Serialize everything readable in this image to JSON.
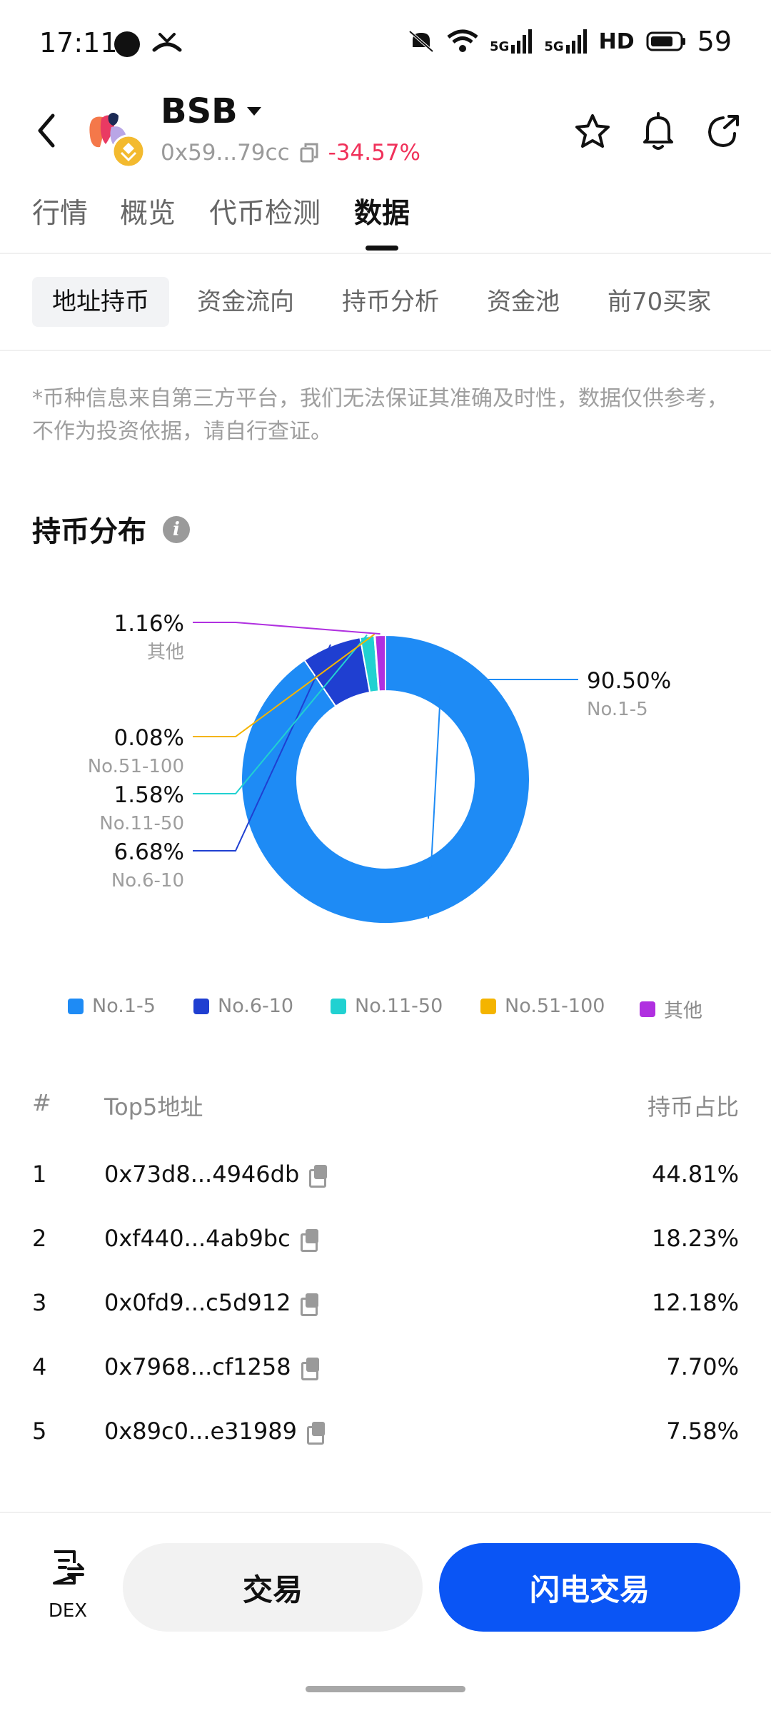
{
  "status_bar": {
    "time": "17:11",
    "battery": "59",
    "net1": "5G",
    "net2": "5G",
    "hd": "HD"
  },
  "header": {
    "token_name": "BSB",
    "address": "0x59...79cc",
    "change": "-34.57%"
  },
  "main_tabs": [
    {
      "label": "行情"
    },
    {
      "label": "概览"
    },
    {
      "label": "代币检测"
    },
    {
      "label": "数据",
      "active": true
    }
  ],
  "sub_tabs": [
    {
      "label": "地址持币",
      "active": true
    },
    {
      "label": "资金流向"
    },
    {
      "label": "持币分析"
    },
    {
      "label": "资金池"
    },
    {
      "label": "前70买家"
    }
  ],
  "disclaimer": "*币种信息来自第三方平台，我们无法保证其准确及时性，数据仅供参考，不作为投资依据，请自行查证。",
  "section_title": "持币分布",
  "chart_data": {
    "type": "pie",
    "donut": true,
    "categories": [
      "No.1-5",
      "No.6-10",
      "No.11-50",
      "No.51-100",
      "其他"
    ],
    "values": [
      90.5,
      6.68,
      1.58,
      0.08,
      1.16
    ],
    "value_labels": [
      "90.50%",
      "6.68%",
      "1.58%",
      "0.08%",
      "1.16%"
    ],
    "colors": [
      "#1e8bf5",
      "#1f3fd1",
      "#21d1d1",
      "#f4b400",
      "#b030e0"
    ],
    "legend_position": "bottom"
  },
  "table": {
    "headers": {
      "index": "#",
      "address": "Top5地址",
      "share": "持币占比"
    },
    "rows": [
      {
        "index": "1",
        "address": "0x73d8...4946db",
        "share": "44.81%"
      },
      {
        "index": "2",
        "address": "0xf440...4ab9bc",
        "share": "18.23%"
      },
      {
        "index": "3",
        "address": "0x0fd9...c5d912",
        "share": "12.18%"
      },
      {
        "index": "4",
        "address": "0x7968...cf1258",
        "share": "7.70%"
      },
      {
        "index": "5",
        "address": "0x89c0...e31989",
        "share": "7.58%"
      }
    ]
  },
  "bottom_bar": {
    "dex_label": "DEX",
    "trade_label": "交易",
    "flash_trade_label": "闪电交易"
  }
}
